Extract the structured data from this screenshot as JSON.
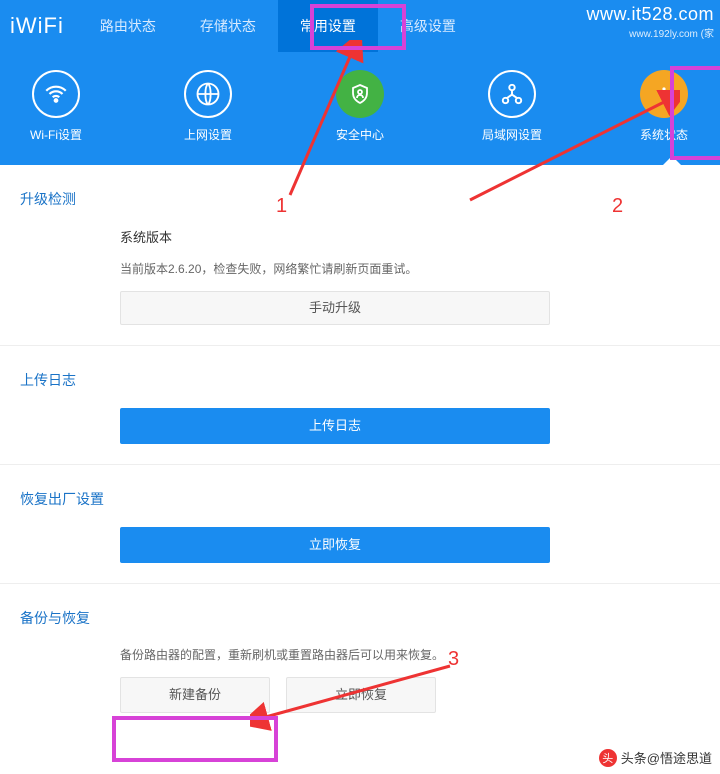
{
  "logo": "iWiFi",
  "watermark": {
    "line1": "www.it528.com",
    "line2": "www.192ly.com (家"
  },
  "nav": {
    "items": [
      {
        "label": "路由状态"
      },
      {
        "label": "存储状态"
      },
      {
        "label": "常用设置",
        "active": true
      },
      {
        "label": "高级设置"
      }
    ]
  },
  "iconrow": {
    "items": [
      {
        "label": "Wi-Fi设置",
        "icon": "wifi-icon"
      },
      {
        "label": "上网设置",
        "icon": "globe-icon"
      },
      {
        "label": "安全中心",
        "icon": "shield-icon"
      },
      {
        "label": "局域网设置",
        "icon": "lan-icon"
      },
      {
        "label": "系统状态",
        "icon": "info-icon",
        "active": true
      }
    ]
  },
  "sections": {
    "upgrade": {
      "title": "升级检测",
      "version_label": "系统版本",
      "version_text": "当前版本2.6.20，检查失败，网络繁忙请刷新页面重试。",
      "manual_btn": "手动升级"
    },
    "log": {
      "title": "上传日志",
      "upload_btn": "上传日志"
    },
    "factory": {
      "title": "恢复出厂设置",
      "restore_btn": "立即恢复"
    },
    "backup": {
      "title": "备份与恢复",
      "desc": "备份路由器的配置，重新刷机或重置路由器后可以用来恢复。",
      "new_backup_btn": "新建备份",
      "restore_btn": "立即恢复"
    }
  },
  "annotations": {
    "num1": "1",
    "num2": "2",
    "num3": "3"
  },
  "attribution": "头条@悟途思道"
}
